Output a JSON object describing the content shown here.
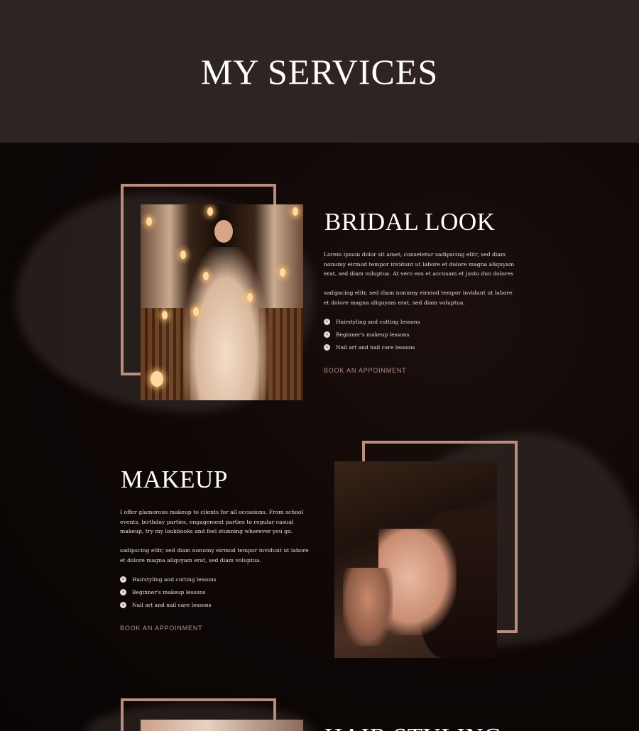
{
  "hero": {
    "title": "MY SERVICES"
  },
  "services": [
    {
      "title": "BRIDAL LOOK",
      "paragraphs": [
        "Lorem ipsum dolor sit amet, consetetur sadipscing elitr, sed diam nonumy eirmod tempor invidunt ut labore et dolore magna aliquyam erat, sed diam voluptua. At vero eos et accusam et justo duo dolores",
        "sadipscing elitr, sed diam nonumy eirmod tempor invidunt ut labore et dolore magna aliquyam erat, sed diam voluptua."
      ],
      "list": [
        "Hairstyling and cutting lessons",
        "Beginner's makeup lessons",
        "Nail art and nail care lessons"
      ],
      "cta": "BOOK AN APPOINMENT"
    },
    {
      "title": "MAKEUP",
      "paragraphs": [
        "I offer glamorous makeup to clients for all occasions. From school events, birthday parties, engagement parties to regular casual makeup, try my lookbooks and feel stunning wherever you go.",
        "sadipscing elitr, sed diam nonumy eirmod tempor invidunt ut labore et dolore magna aliquyam erat, sed diam voluptua."
      ],
      "list": [
        "Hairstyling and cutting lessons",
        "Beginner's makeup lessons",
        "Nail art and nail care lessons"
      ],
      "cta": "BOOK AN APPOINMENT"
    },
    {
      "title": "HAIR STYLING"
    }
  ],
  "icons": {
    "list_bullet": "chevron-right-circle-icon",
    "bullet_glyph": "›"
  },
  "colors": {
    "hero_bg": "#2e2423",
    "section_bg": "#0d0808",
    "frame": "#b88e7d",
    "cta": "#b0928a"
  }
}
